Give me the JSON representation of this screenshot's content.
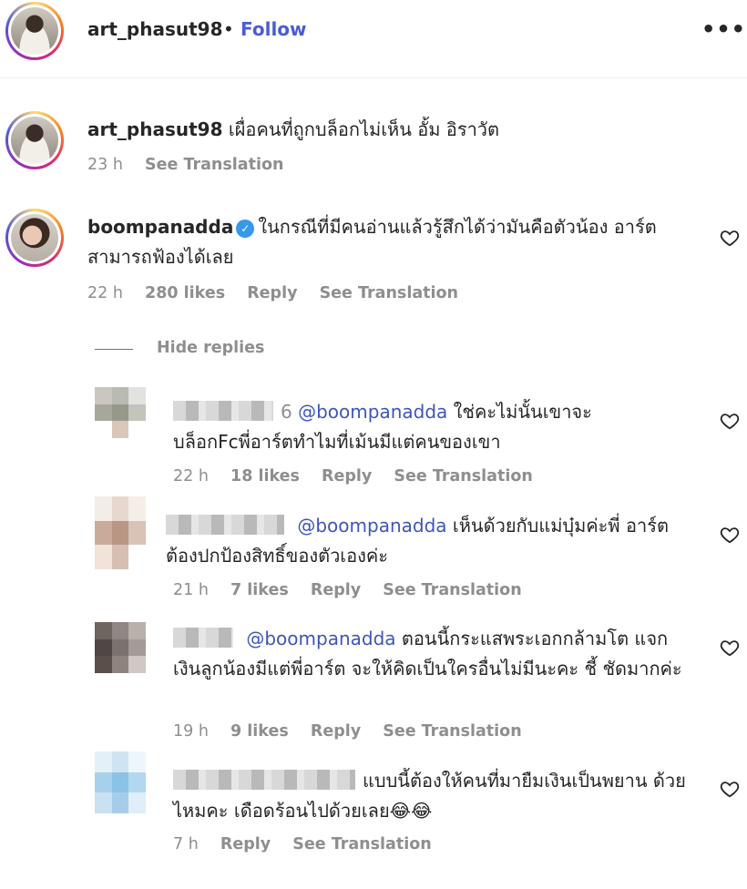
{
  "header": {
    "username": "art_phasut98",
    "separator": "•",
    "follow_label": "Follow",
    "more_label": "•••"
  },
  "caption": {
    "username": "art_phasut98",
    "text": "เผื่อคนที่ถูกบล็อกไม่เห็น อั้ม อิราวัต",
    "time": "23 h",
    "see_translation": "See Translation"
  },
  "comment": {
    "username": "boompanadda",
    "verified_mark": "✓",
    "text": "ในกรณีที่มีคนอ่านแล้วรู้สึกได้ว่ามันคือตัวน้อง อาร์ต สามารถฟ้องได้เลย",
    "time": "22 h",
    "likes": "280 likes",
    "reply": "Reply",
    "see_translation": "See Translation"
  },
  "hide_replies": "Hide replies",
  "replies": [
    {
      "name_suffix": "6",
      "mention": "@boompanadda",
      "text": "ใช่คะไม่นั้นเขาจะ บล็อกFcพี่อาร์ตทำไมที่เม้นมีแต่คนของเขา",
      "time": "22 h",
      "likes": "18 likes",
      "reply": "Reply",
      "see_translation": "See Translation"
    },
    {
      "name_suffix": "",
      "mention": "@boompanadda",
      "text": "เห็นด้วยกับแม่บุ๋มค่ะพี่ อาร์ตต้องปกป้องสิทธิ์ของตัวเองค่ะ",
      "time": "21 h",
      "likes": "7 likes",
      "reply": "Reply",
      "see_translation": "See Translation"
    },
    {
      "name_suffix": "",
      "mention": "@boompanadda",
      "text": "ตอนนี้กระแสพระเอกกล้ามโต แจกเงินลูกน้องมีแต่พี่อาร์ต จะให้คิดเป็นใครอื่นไม่มีนะคะ ชี้ ชัดมากค่ะ",
      "time": "19 h",
      "likes": "9 likes",
      "reply": "Reply",
      "see_translation": "See Translation"
    },
    {
      "name_suffix": "",
      "mention": "",
      "text": "แบบนี้ต้องให้คนที่มายืมเงินเป็นพยาน ด้วยไหมคะ เดือดร้อนไปด้วยเลย😂😂",
      "time": "7 h",
      "likes": "",
      "reply": "Reply",
      "see_translation": "See Translation"
    }
  ],
  "colors": {
    "link": "#4a5bd8",
    "mention": "#3e56b6",
    "meta": "#8e8e8e",
    "verified": "#3897f0"
  },
  "icons": {
    "more": "more-horizontal-icon",
    "like": "heart-outline-icon",
    "verified": "verified-badge-icon"
  }
}
